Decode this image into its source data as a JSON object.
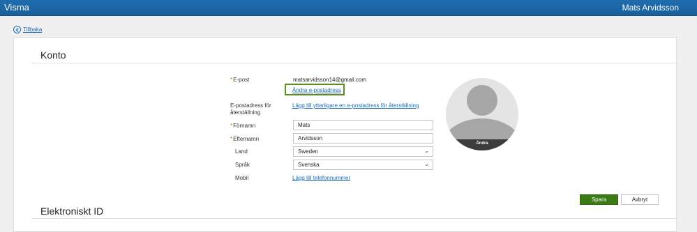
{
  "app": {
    "brand": "Visma",
    "user_name": "Mats Arvidsson"
  },
  "nav": {
    "back_label": "Tillbaka"
  },
  "account": {
    "title": "Konto",
    "email_label": "E-post",
    "email_value": "matsarvidsson14@gmail.com",
    "change_email_link": "Ändra e-postadress",
    "recovery_label_line1": "E-postadress för",
    "recovery_label_line2": "återställning",
    "recovery_link": "Lägg till ytterligare en e-postadress för återställning",
    "first_name_label": "Förnamn",
    "first_name_value": "Mats",
    "last_name_label": "Efternamn",
    "last_name_value": "Arvidsson",
    "country_label": "Land",
    "country_value": "Sweden",
    "language_label": "Språk",
    "language_value": "Svenska",
    "mobile_label": "Mobil",
    "mobile_link": "Lägg till telefonnummer",
    "avatar_caption": "Ändra",
    "required_marker": "*"
  },
  "actions": {
    "save_label": "Spara",
    "cancel_label": "Avbryt"
  },
  "electronic_id": {
    "title": "Elektroniskt ID"
  },
  "icons": {
    "back": "chevron-left-circle-icon",
    "dropdown": "chevron-down-icon"
  },
  "colors": {
    "topbar": "#1f6cae",
    "link": "#1d6bb3",
    "primary": "#3b7a14",
    "highlight": "#5d8f1f",
    "required": "#e06b00"
  }
}
